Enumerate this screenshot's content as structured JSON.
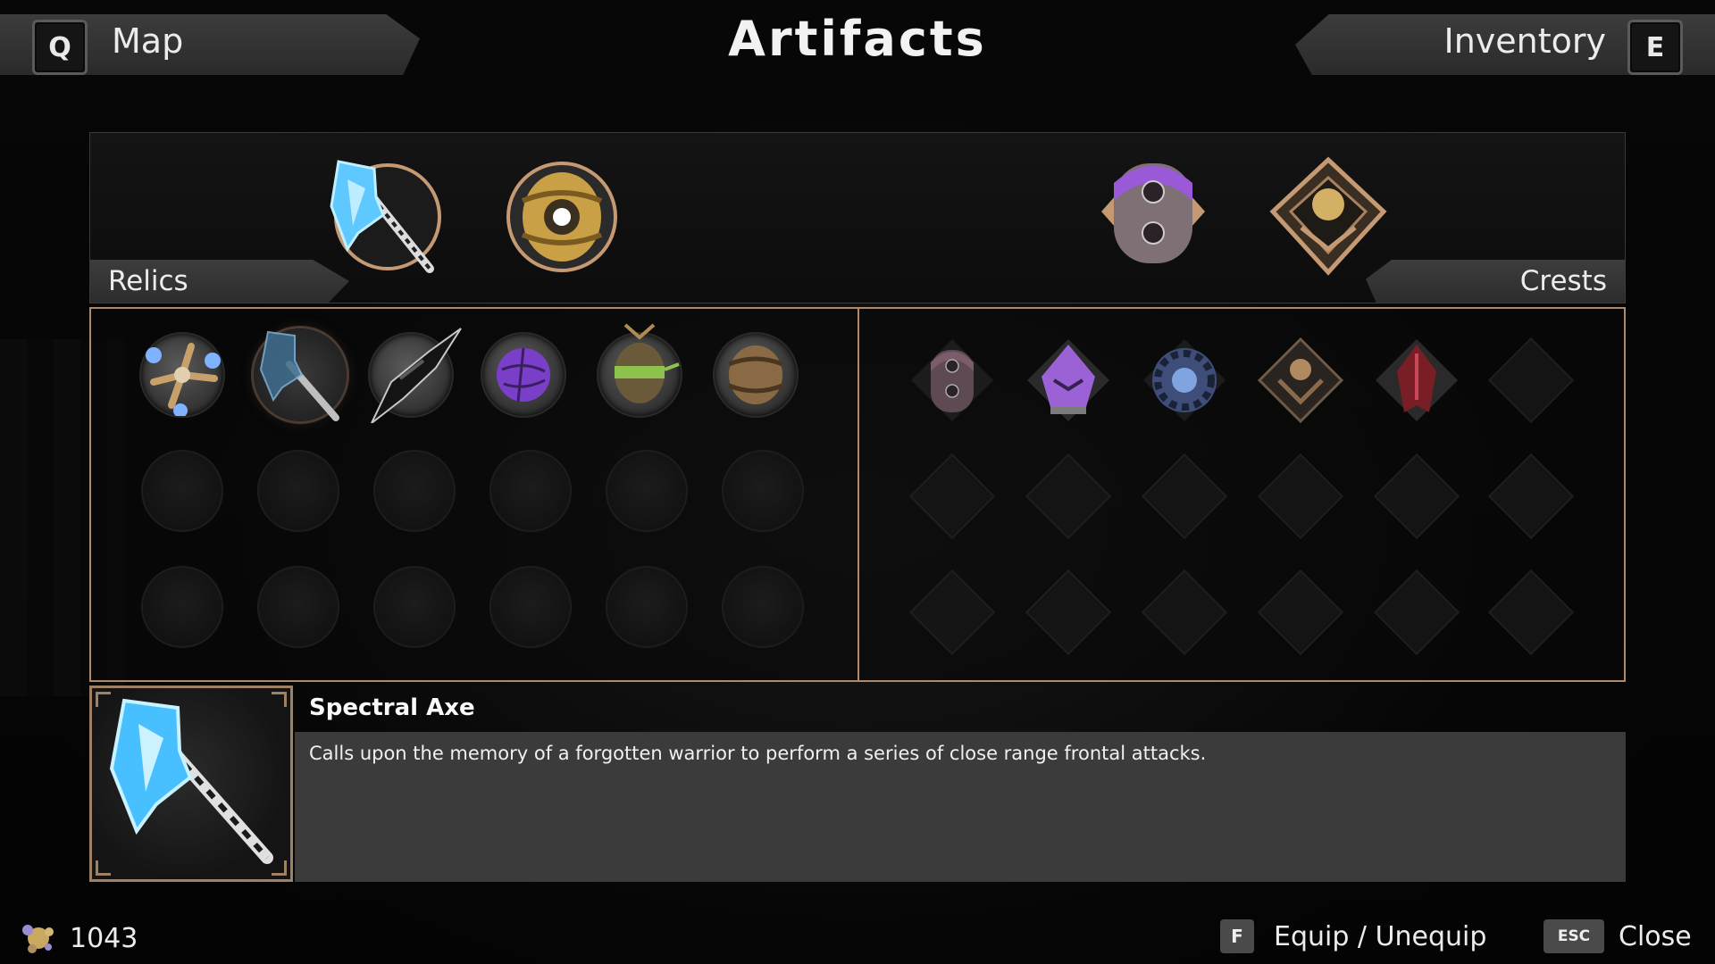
{
  "header": {
    "title": "Artifacts",
    "left": {
      "key": "Q",
      "label": "Map"
    },
    "right": {
      "key": "E",
      "label": "Inventory"
    }
  },
  "equipped": {
    "relics_label": "Relics",
    "crests_label": "Crests",
    "relics": [
      {
        "icon": "spectral-axe-icon",
        "name": "Spectral Axe"
      },
      {
        "icon": "golden-orb-icon"
      }
    ],
    "crests": [
      {
        "icon": "purple-crest-icon"
      },
      {
        "icon": "golden-crest-icon"
      }
    ]
  },
  "relic_grid": {
    "rows": 3,
    "cols": 6,
    "items": [
      {
        "icon": "four-pronged-relic-icon",
        "accent": "#7fb3ff"
      },
      {
        "icon": "spectral-axe-icon",
        "accent": "#66d0ff",
        "selected": true
      },
      {
        "icon": "shadow-blade-icon",
        "accent": "#1c1c1c"
      },
      {
        "icon": "violet-orb-icon",
        "accent": "#8a4fd8"
      },
      {
        "icon": "green-lantern-icon",
        "accent": "#8dc34c"
      },
      {
        "icon": "bronze-orb-icon",
        "accent": "#a07440"
      }
    ]
  },
  "crest_grid": {
    "rows": 3,
    "cols": 6,
    "items": [
      {
        "icon": "bronze-shield-crest-icon",
        "accent": "#7a5c6c"
      },
      {
        "icon": "violet-helm-crest-icon",
        "accent": "#9a62d4"
      },
      {
        "icon": "blue-gear-crest-icon",
        "accent": "#6c8fd0"
      },
      {
        "icon": "dark-gold-crest-icon",
        "accent": "#b08a60"
      },
      {
        "icon": "crimson-crest-icon",
        "accent": "#a8323c"
      }
    ]
  },
  "detail": {
    "name": "Spectral Axe",
    "description": "Calls upon the memory of a forgotten warrior to perform a series of close range frontal attacks."
  },
  "footer": {
    "currency": "1043",
    "equip": {
      "key": "F",
      "label": "Equip / Unequip"
    },
    "close": {
      "key": "ESC",
      "label": "Close"
    }
  },
  "colors": {
    "frame": "#b08a68",
    "spectral": "#6fd6ff",
    "panel_bg": "#0c0c0c",
    "desc_bg": "#3b3b3b"
  }
}
